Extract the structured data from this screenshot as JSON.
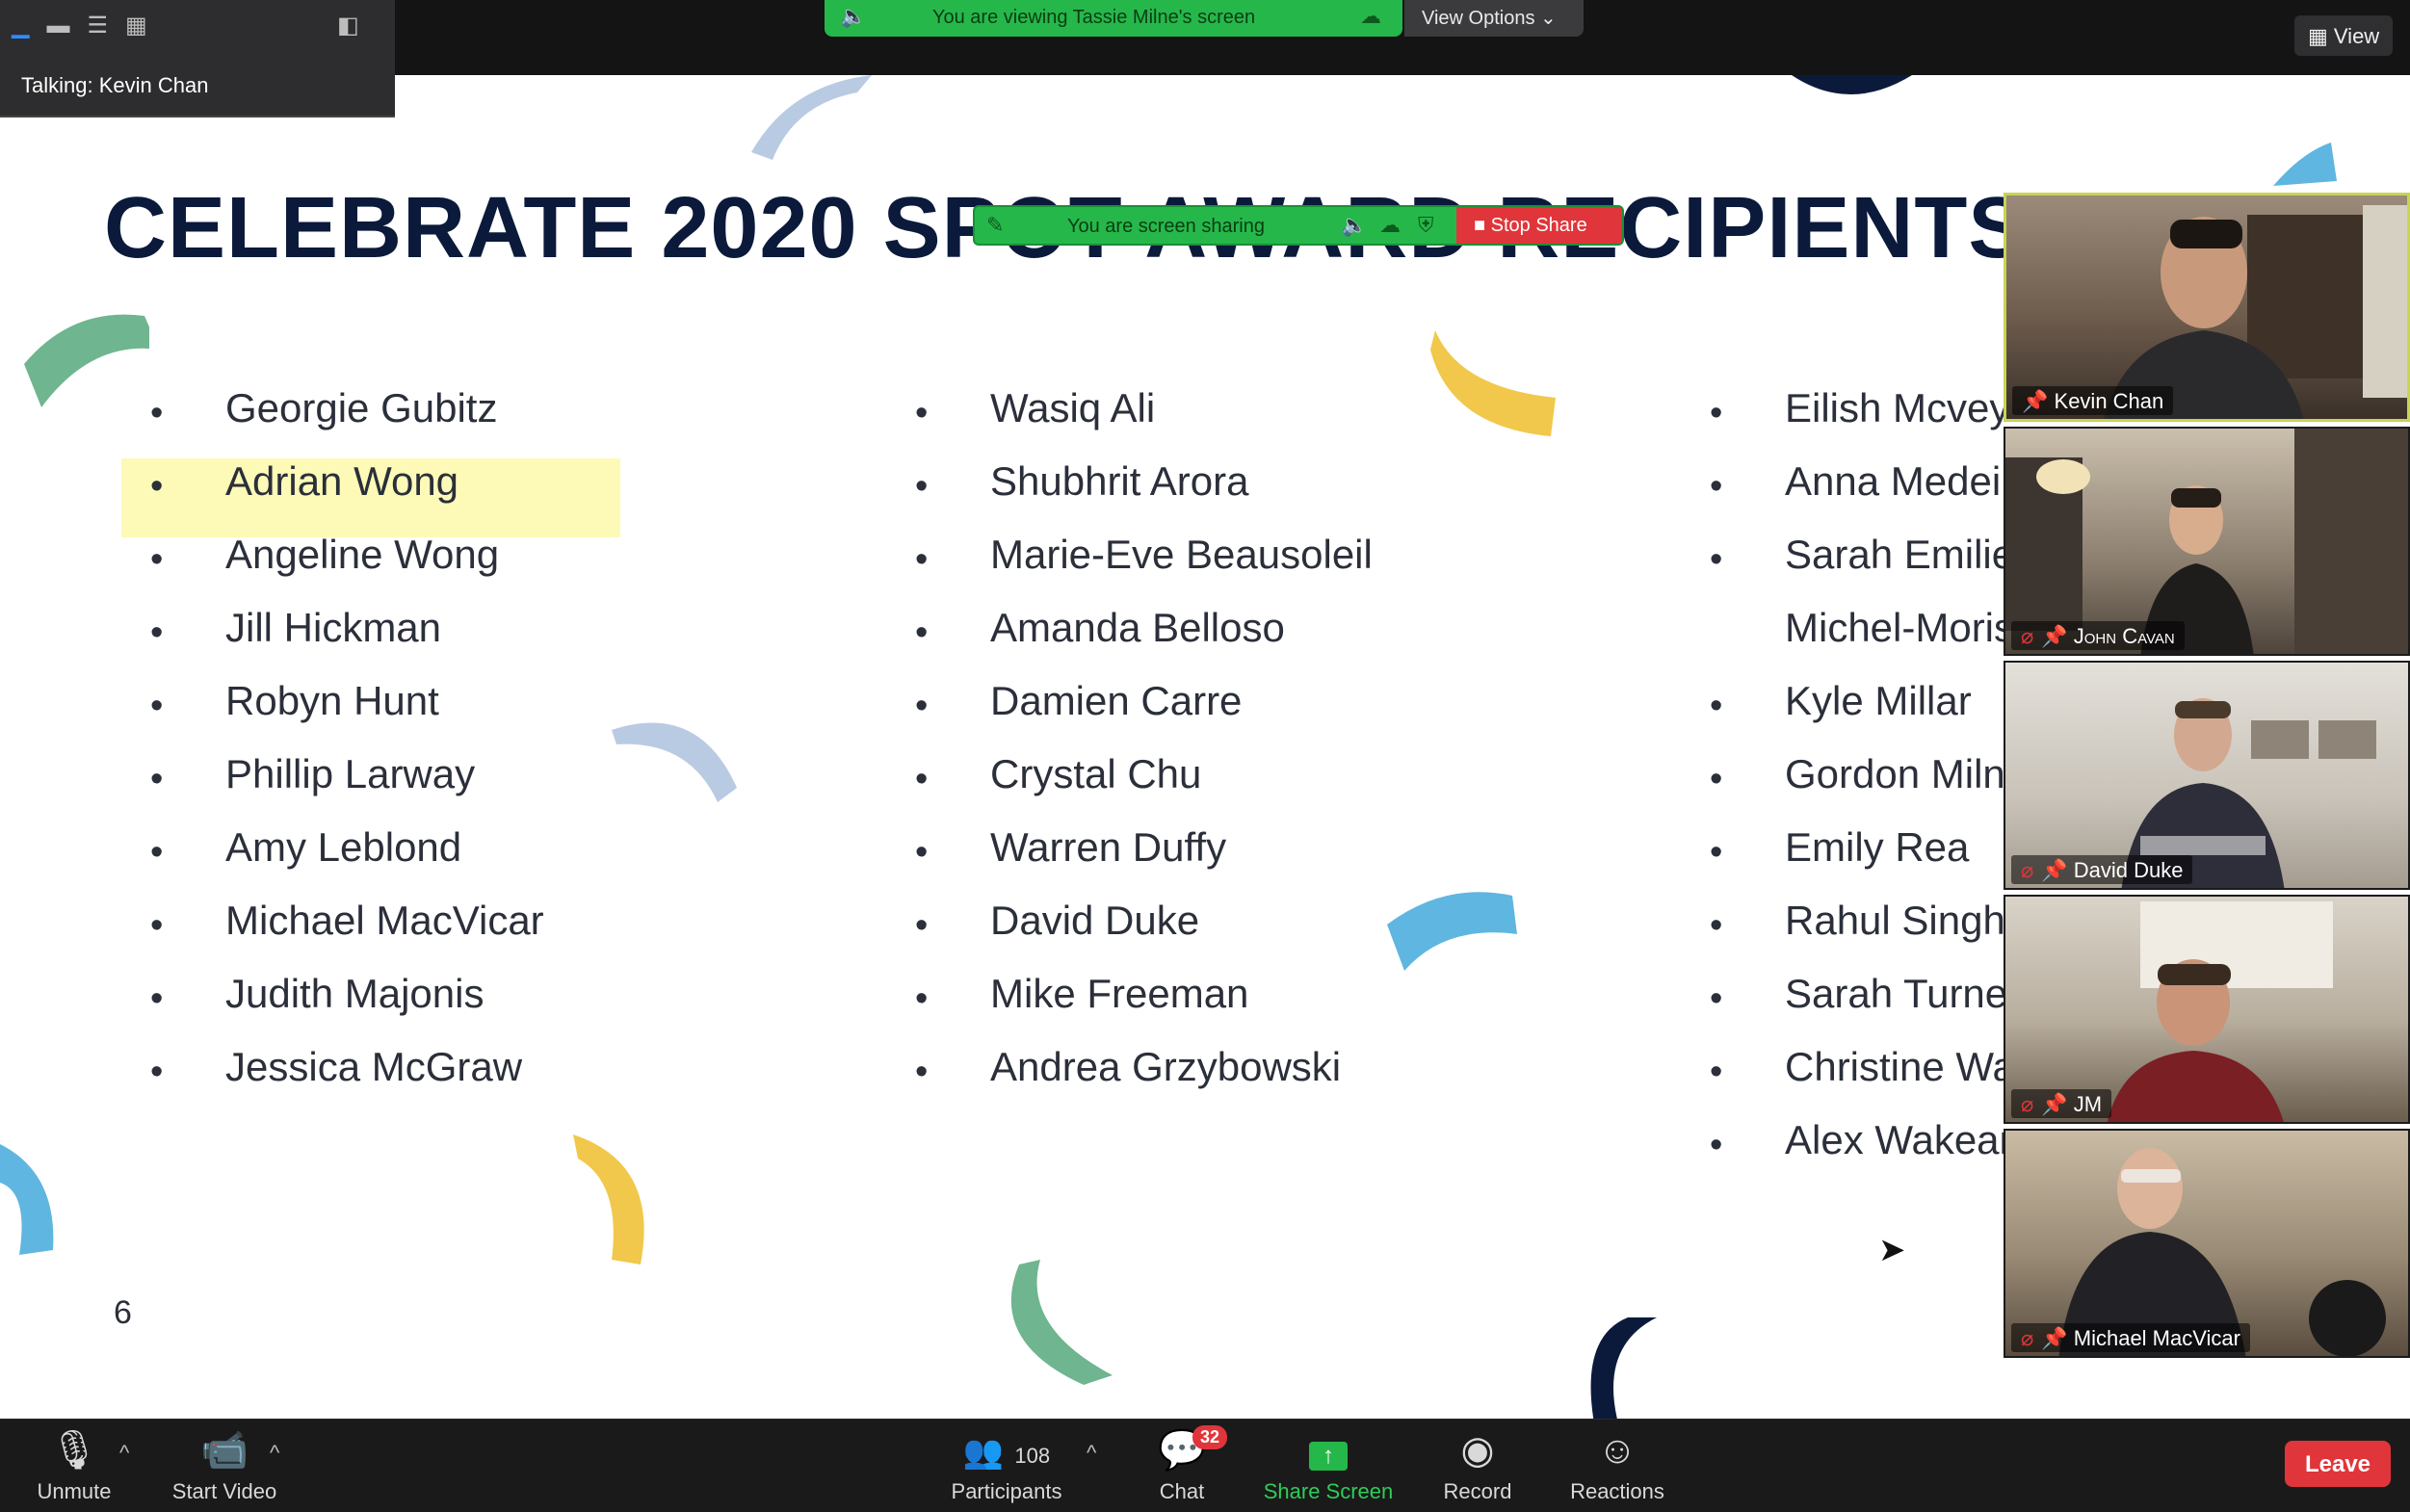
{
  "top": {
    "talking": "Talking: Kevin Chan",
    "viewing_banner": "You are viewing Tassie Milne's screen",
    "view_options": "View Options ⌄",
    "view_button": "View"
  },
  "share_bar": {
    "text": "You are screen sharing",
    "stop_label": "Stop Share"
  },
  "slide": {
    "title": "CELEBRATE 2020 SPOT AWARD RECIPIENTS",
    "page_number": "6",
    "columns": [
      [
        "Georgie Gubitz",
        "Adrian Wong",
        "Angeline Wong",
        "Jill Hickman",
        "Robyn Hunt",
        "Phillip Larway",
        "Amy Leblond",
        "Michael MacVicar",
        "Judith Majonis",
        "Jessica McGraw"
      ],
      [
        "Wasiq Ali",
        "Shubhrit Arora",
        "Marie-Eve Beausoleil",
        "Amanda Belloso",
        "Damien Carre",
        "Crystal Chu",
        "Warren Duffy",
        "David Duke",
        "Mike Freeman",
        "Andrea Grzybowski"
      ],
      [
        "Eilish Mcvey",
        "Anna Medei",
        "Sarah Emilie",
        "Michel-Moris",
        "Kyle Millar",
        "Gordon Milne",
        "Emily Rea",
        "Rahul Singh",
        "Sarah Turner",
        "Christine Wa",
        "Alex Wakeam"
      ]
    ],
    "col3_no_bullet_index": 3,
    "highlighted": "Adrian Wong"
  },
  "participants": [
    {
      "name": "Kevin Chan",
      "muted": false,
      "speaking": true
    },
    {
      "name": "John Cavan",
      "muted": true,
      "speaking": false
    },
    {
      "name": "David Duke",
      "muted": true,
      "speaking": false
    },
    {
      "name": "JM",
      "muted": true,
      "speaking": false
    },
    {
      "name": "Michael MacVicar",
      "muted": true,
      "speaking": false
    }
  ],
  "toolbar": {
    "unmute": "Unmute",
    "start_video": "Start Video",
    "participants_count": "108",
    "participants": "Participants",
    "chat": "Chat",
    "chat_badge": "32",
    "share_screen": "Share Screen",
    "record": "Record",
    "reactions": "Reactions",
    "leave": "Leave"
  },
  "colors": {
    "accent_green": "#26b74a",
    "leave_red": "#e0353a",
    "title_navy": "#0b1a3b",
    "highlight_yellow": "#fdfab7"
  }
}
